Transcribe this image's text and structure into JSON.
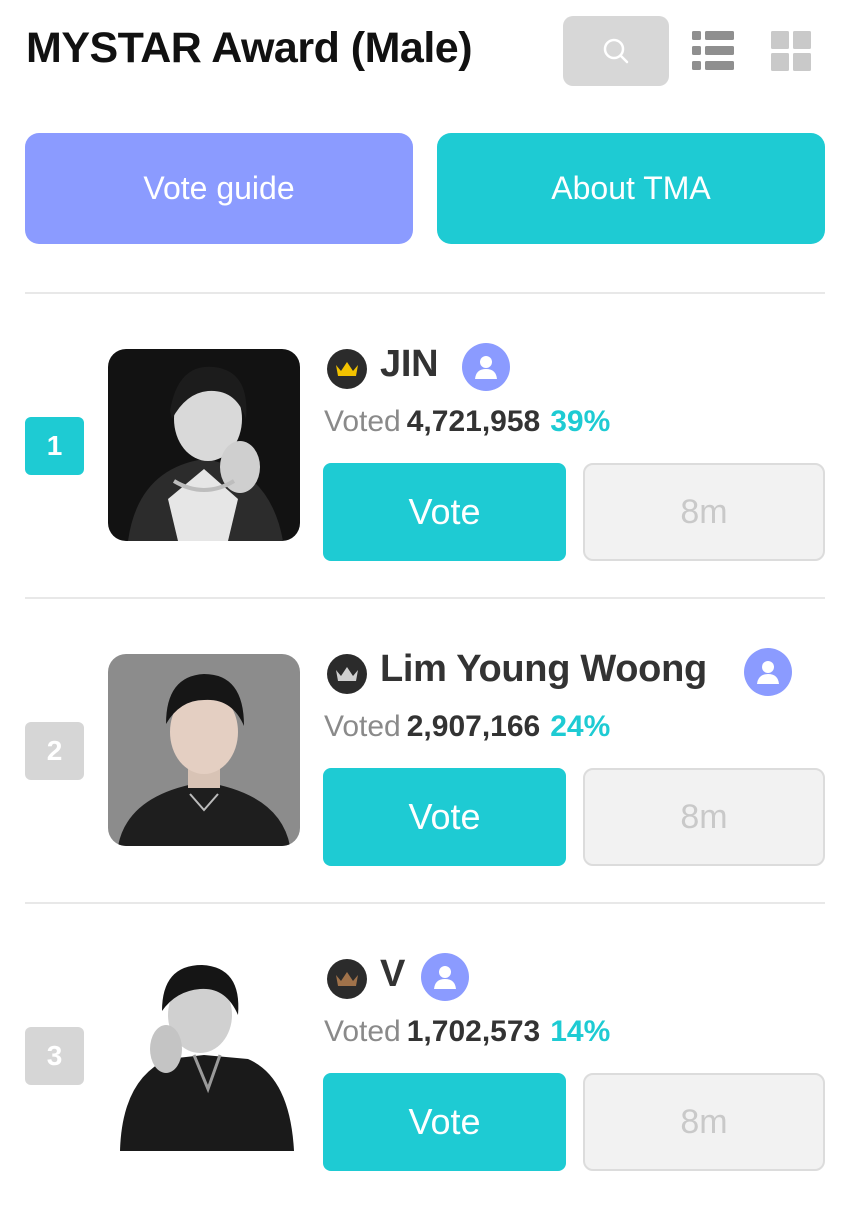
{
  "header": {
    "title": "MYSTAR Award (Male)",
    "icons": [
      "search-icon",
      "list-view-icon",
      "grid-view-icon"
    ]
  },
  "buttons": {
    "vote_guide": "Vote guide",
    "about": "About TMA"
  },
  "colors": {
    "accent": "#1ecbd3",
    "guide": "#8b9bff",
    "rank_inactive": "#d6d6d6",
    "timer_bg": "#f2f2f2",
    "crown_gold": "#f2c200",
    "crown_silver": "#cfcfcf",
    "crown_bronze": "#a0724a"
  },
  "entries": [
    {
      "rank": "1",
      "name": "JIN",
      "voted_label": "Voted",
      "votes": "4,721,958",
      "percent": "39%",
      "vote_label": "Vote",
      "timer": "8m",
      "crown": "gold-crown-icon"
    },
    {
      "rank": "2",
      "name": "Lim Young Woong",
      "voted_label": "Voted",
      "votes": "2,907,166",
      "percent": "24%",
      "vote_label": "Vote",
      "timer": "8m",
      "crown": "silver-crown-icon"
    },
    {
      "rank": "3",
      "name": "V",
      "voted_label": "Voted",
      "votes": "1,702,573",
      "percent": "14%",
      "vote_label": "Vote",
      "timer": "8m",
      "crown": "bronze-crown-icon"
    }
  ]
}
